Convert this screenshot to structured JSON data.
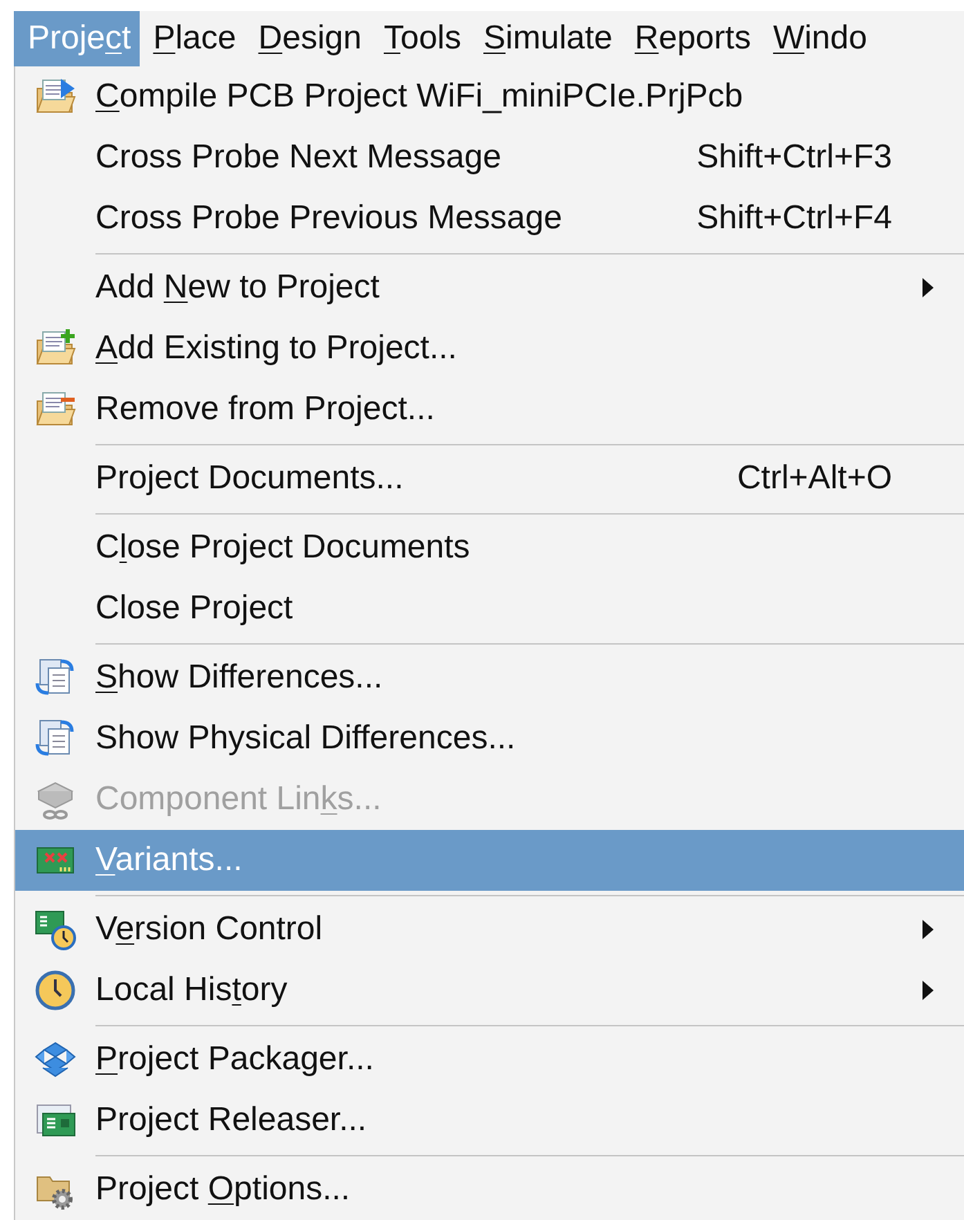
{
  "menubar": [
    {
      "label_before": "Proje",
      "access_key": "c",
      "label_after": "t",
      "selected": true
    },
    {
      "access_key": "P",
      "label_after": "lace",
      "selected": false
    },
    {
      "access_key": "D",
      "label_after": "esign",
      "selected": false
    },
    {
      "access_key": "T",
      "label_after": "ools",
      "selected": false
    },
    {
      "access_key": "S",
      "label_after": "imulate",
      "selected": false
    },
    {
      "access_key": "R",
      "label_after": "eports",
      "selected": false
    },
    {
      "access_key": "W",
      "label_after": "indo",
      "selected": false
    }
  ],
  "menu": [
    {
      "kind": "item",
      "access_key": "C",
      "label_after": "ompile PCB Project WiFi_miniPCIe.PrjPcb",
      "selected": false,
      "disabled": false,
      "submenu": false
    },
    {
      "kind": "item",
      "label": "Cross Probe Next Message",
      "shortcut": "Shift+Ctrl+F3",
      "selected": false,
      "disabled": false,
      "submenu": false
    },
    {
      "kind": "item",
      "label": "Cross Probe Previous Message",
      "shortcut": "Shift+Ctrl+F4",
      "selected": false,
      "disabled": false,
      "submenu": false
    },
    {
      "kind": "separator"
    },
    {
      "kind": "item",
      "label_before": "Add ",
      "access_key": "N",
      "label_after": "ew to Project",
      "selected": false,
      "disabled": false,
      "submenu": true
    },
    {
      "kind": "item",
      "access_key": "A",
      "label_after": "dd Existing to Project...",
      "selected": false,
      "disabled": false,
      "submenu": false
    },
    {
      "kind": "item",
      "label": "Remove from Project...",
      "selected": false,
      "disabled": false,
      "submenu": false
    },
    {
      "kind": "separator"
    },
    {
      "kind": "item",
      "label": "Project Documents...",
      "shortcut": "Ctrl+Alt+O",
      "selected": false,
      "disabled": false,
      "submenu": false
    },
    {
      "kind": "separator"
    },
    {
      "kind": "item",
      "label_before": "C",
      "access_key": "l",
      "label_after": "ose Project Documents",
      "selected": false,
      "disabled": false,
      "submenu": false
    },
    {
      "kind": "item",
      "label": "Close Project",
      "selected": false,
      "disabled": false,
      "submenu": false
    },
    {
      "kind": "separator"
    },
    {
      "kind": "item",
      "access_key": "S",
      "label_after": "how Differences...",
      "selected": false,
      "disabled": false,
      "submenu": false
    },
    {
      "kind": "item",
      "label": "Show Physical Differences...",
      "selected": false,
      "disabled": false,
      "submenu": false
    },
    {
      "kind": "item",
      "label_before": "Component Lin",
      "access_key": "k",
      "label_after": "s...",
      "selected": false,
      "disabled": true,
      "submenu": false
    },
    {
      "kind": "item",
      "access_key": "V",
      "label_after": "ariants...",
      "selected": true,
      "disabled": false,
      "submenu": false
    },
    {
      "kind": "separator"
    },
    {
      "kind": "item",
      "label_before": "V",
      "access_key": "e",
      "label_after": "rsion Control",
      "selected": false,
      "disabled": false,
      "submenu": true
    },
    {
      "kind": "item",
      "label_before": "Local His",
      "access_key": "t",
      "label_after": "ory",
      "selected": false,
      "disabled": false,
      "submenu": true
    },
    {
      "kind": "separator"
    },
    {
      "kind": "item",
      "access_key": "P",
      "label_after": "roject Packager...",
      "selected": false,
      "disabled": false,
      "submenu": false
    },
    {
      "kind": "item",
      "label": "Project Releaser...",
      "selected": false,
      "disabled": false,
      "submenu": false
    },
    {
      "kind": "separator"
    },
    {
      "kind": "item",
      "label_before": "Project ",
      "access_key": "O",
      "label_after": "ptions...",
      "selected": false,
      "disabled": false,
      "submenu": false
    }
  ]
}
